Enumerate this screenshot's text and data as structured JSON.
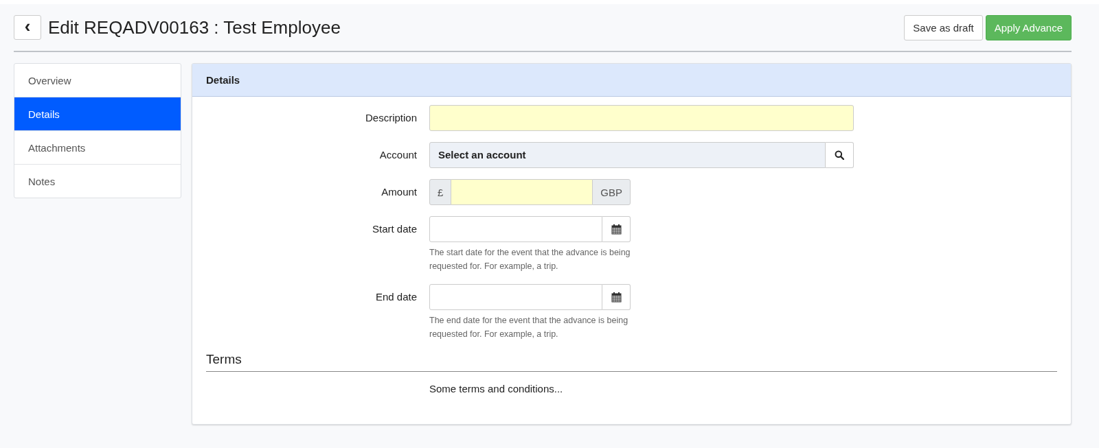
{
  "header": {
    "back_icon": "‹",
    "title": "Edit REQADV00163 : Test Employee",
    "buttons": [
      {
        "label": "Save as draft",
        "kind": "default"
      },
      {
        "label": "Apply Advance",
        "kind": "primary"
      }
    ]
  },
  "sidebar": {
    "items": [
      {
        "label": "Overview",
        "selected": false
      },
      {
        "label": "Details",
        "selected": true
      },
      {
        "label": "Attachments",
        "selected": false
      },
      {
        "label": "Notes",
        "selected": false
      }
    ]
  },
  "panel": {
    "title": "Details",
    "fields": [
      {
        "label": "Description",
        "kind": "text"
      },
      {
        "label": "Account",
        "kind": "lookup",
        "value": "Select an account"
      },
      {
        "label": "Amount",
        "kind": "currency",
        "prefix": "£",
        "suffix": "GBP"
      },
      {
        "label": "Start date",
        "kind": "date",
        "help": "The start date for the event that the advance is being requested for. For example, a trip."
      },
      {
        "label": "End date",
        "kind": "date",
        "help": "The end date for the event that the advance is being requested for. For example, a trip."
      }
    ],
    "terms": {
      "heading": "Terms",
      "text": "Some terms and conditions..."
    }
  }
}
